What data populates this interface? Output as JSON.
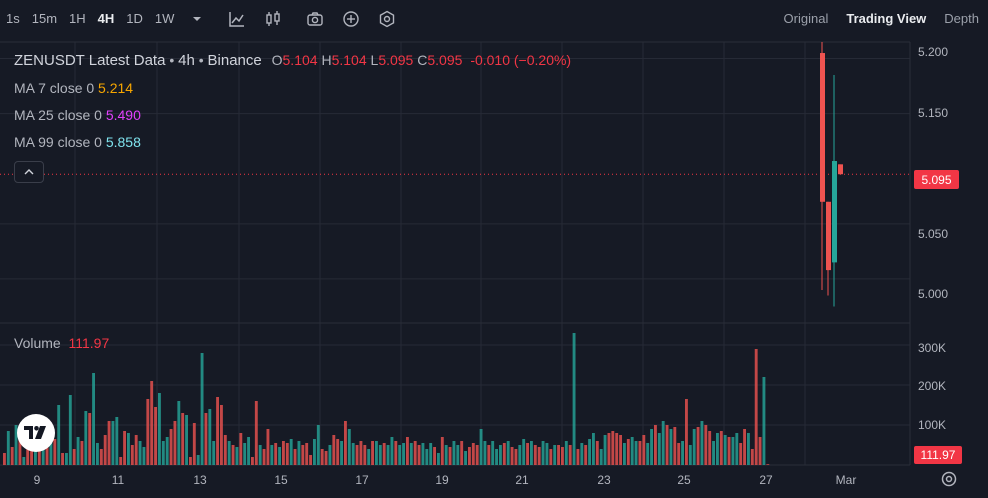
{
  "toolbar": {
    "timeframes": [
      {
        "label": "1s",
        "active": false
      },
      {
        "label": "15m",
        "active": false
      },
      {
        "label": "1H",
        "active": false
      },
      {
        "label": "4H",
        "active": true
      },
      {
        "label": "1D",
        "active": false
      },
      {
        "label": "1W",
        "active": false
      }
    ],
    "icons": [
      "chevron-down-icon",
      "line-chart-icon",
      "candlestick-icon",
      "camera-icon",
      "plus-circle-icon",
      "settings-hex-icon"
    ],
    "views": [
      {
        "label": "Original",
        "active": false
      },
      {
        "label": "Trading View",
        "active": true
      },
      {
        "label": "Depth",
        "active": false
      }
    ]
  },
  "legend": {
    "title": "ZENUSDT Latest Data",
    "sep1": " • ",
    "interval": "4h",
    "sep2": " • ",
    "exchange": "Binance",
    "o_label": "O",
    "o": "5.104",
    "h_label": "H",
    "h": "5.104",
    "l_label": "L",
    "l": "5.095",
    "c_label": "C",
    "c": "5.095",
    "change": "-0.010 (−0.20%)",
    "ma": [
      {
        "label": "MA 7 close 0",
        "value": "5.214",
        "color": "#f7a600"
      },
      {
        "label": "MA 25 close 0",
        "value": "5.490",
        "color": "#e040fb"
      },
      {
        "label": "MA 99 close 0",
        "value": "5.858",
        "color": "#7fe3ee"
      }
    ],
    "volume_label": "Volume",
    "volume_value": "111.97"
  },
  "price_axis": {
    "ticks": [
      "5.200",
      "5.150",
      "5.050",
      "5.000"
    ],
    "current_price": "5.095",
    "volume_ticks": [
      "300K",
      "200K",
      "100K"
    ],
    "current_volume": "111.97"
  },
  "time_axis": {
    "ticks": [
      "9",
      "11",
      "13",
      "15",
      "17",
      "19",
      "21",
      "23",
      "25",
      "27",
      "Mar"
    ]
  },
  "colors": {
    "up": "#26a69a",
    "down": "#ef5350",
    "background": "#161a25",
    "grid": "#262a36"
  },
  "chart_data": {
    "type": "candlestick",
    "price_ylim": [
      4.96,
      5.215
    ],
    "volume_ylim": [
      0,
      330000
    ],
    "candles": [
      {
        "o": 5.205,
        "h": 5.215,
        "l": 4.99,
        "c": 5.07
      },
      {
        "o": 5.07,
        "h": 5.07,
        "l": 4.985,
        "c": 5.008
      },
      {
        "o": 5.015,
        "h": 5.185,
        "l": 4.975,
        "c": 5.107
      },
      {
        "o": 5.104,
        "h": 5.104,
        "l": 5.095,
        "c": 5.095
      }
    ],
    "volume": {
      "values": [
        30000,
        85000,
        45000,
        100000,
        75000,
        20000,
        110000,
        110000,
        40000,
        120000,
        60000,
        100000,
        90000,
        65000,
        150000,
        30000,
        30000,
        175000,
        40000,
        70000,
        60000,
        135000,
        130000,
        230000,
        55000,
        40000,
        75000,
        110000,
        110000,
        120000,
        20000,
        85000,
        80000,
        50000,
        75000,
        60000,
        45000,
        165000,
        210000,
        145000,
        180000,
        60000,
        70000,
        90000,
        110000,
        160000,
        130000,
        125000,
        20000,
        105000,
        25000,
        280000,
        130000,
        140000,
        60000,
        170000,
        150000,
        75000,
        60000,
        50000,
        45000,
        80000,
        55000,
        70000,
        20000,
        160000,
        50000,
        40000,
        90000,
        50000,
        55000,
        45000,
        60000,
        55000,
        65000,
        40000,
        60000,
        50000,
        55000,
        25000,
        65000,
        100000,
        40000,
        35000,
        50000,
        75000,
        65000,
        60000,
        110000,
        90000,
        55000,
        50000,
        60000,
        50000,
        40000,
        60000,
        60000,
        50000,
        55000,
        50000,
        70000,
        60000,
        50000,
        55000,
        70000,
        55000,
        60000,
        50000,
        55000,
        40000,
        55000,
        45000,
        30000,
        70000,
        50000,
        45000,
        60000,
        50000,
        60000,
        35000,
        45000,
        55000,
        50000,
        90000,
        60000,
        50000,
        60000,
        40000,
        50000,
        55000,
        60000,
        45000,
        40000,
        50000,
        65000,
        55000,
        60000,
        50000,
        45000,
        60000,
        55000,
        40000,
        50000,
        50000,
        45000,
        60000,
        50000,
        330000,
        40000,
        55000,
        50000,
        65000,
        80000,
        60000,
        40000,
        75000,
        80000,
        85000,
        80000,
        75000,
        55000,
        65000,
        70000,
        60000,
        60000,
        75000,
        55000,
        90000,
        100000,
        80000,
        110000,
        100000,
        90000,
        95000,
        55000,
        60000,
        165000,
        50000,
        90000,
        95000,
        110000,
        100000,
        85000,
        60000,
        80000,
        85000,
        75000,
        70000,
        70000,
        80000,
        55000,
        90000,
        80000,
        40000,
        290000,
        70000,
        220000,
        2000
      ],
      "directions": "drdrdrddrdrdrdrdrrdrdrdrrdddrrddrddrrdddrrrddrdrddrrdrrdddrdrdrrddrddrdrddrdrdddrrddrddrdrrdddrdrrdrrdrrdrddrrrdrdrdrrdrdddrrdrrrdrddrrdrddrrdrddrdrdrdrrdrrddddrdrrddrrdrrdrddrdrrdrddrrdrdrrddrdddrdrd"
    },
    "candle_index_start": 212,
    "total_bars": 216
  }
}
